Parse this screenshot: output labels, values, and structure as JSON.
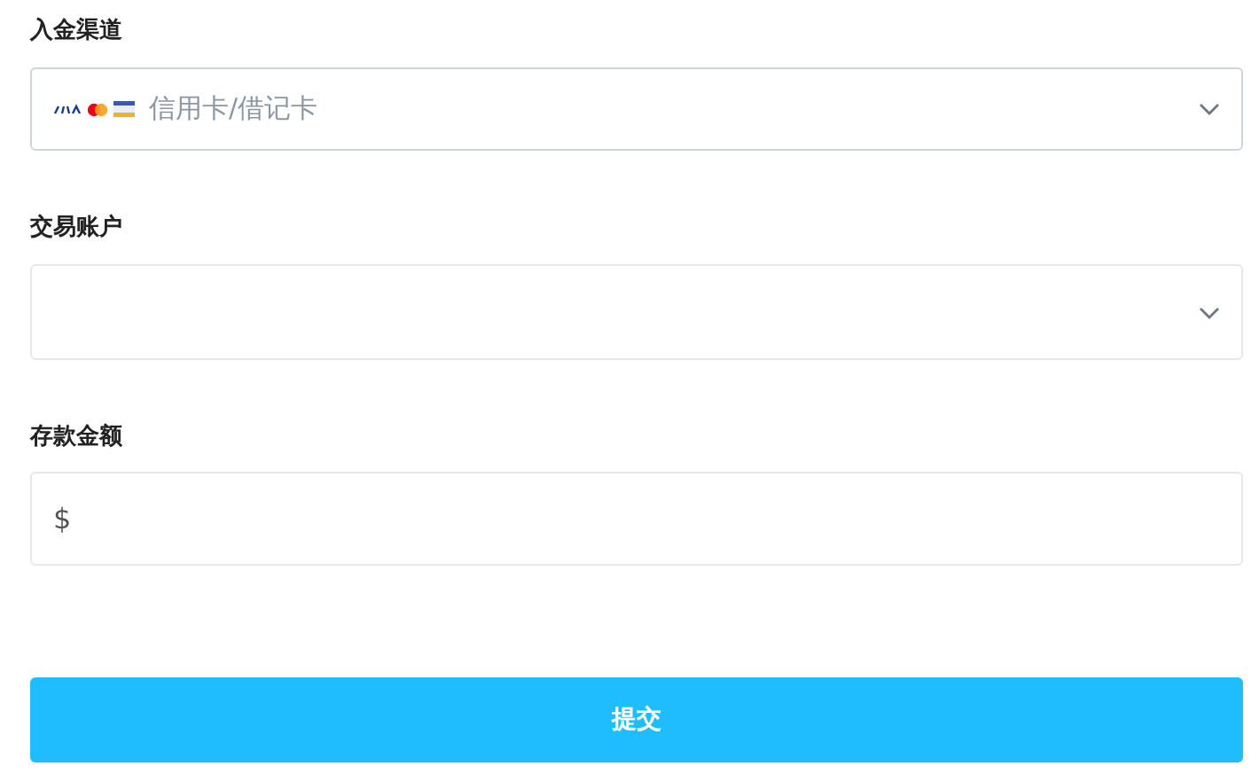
{
  "fields": [
    {
      "kind": "select",
      "label": "入金渠道",
      "value": "信用卡/借记卡",
      "card_icons": true
    },
    {
      "kind": "select",
      "label": "交易账户"
    },
    {
      "kind": "amount",
      "label": "存款金额",
      "prefix": "$"
    }
  ],
  "submit": {
    "label": "提交"
  }
}
